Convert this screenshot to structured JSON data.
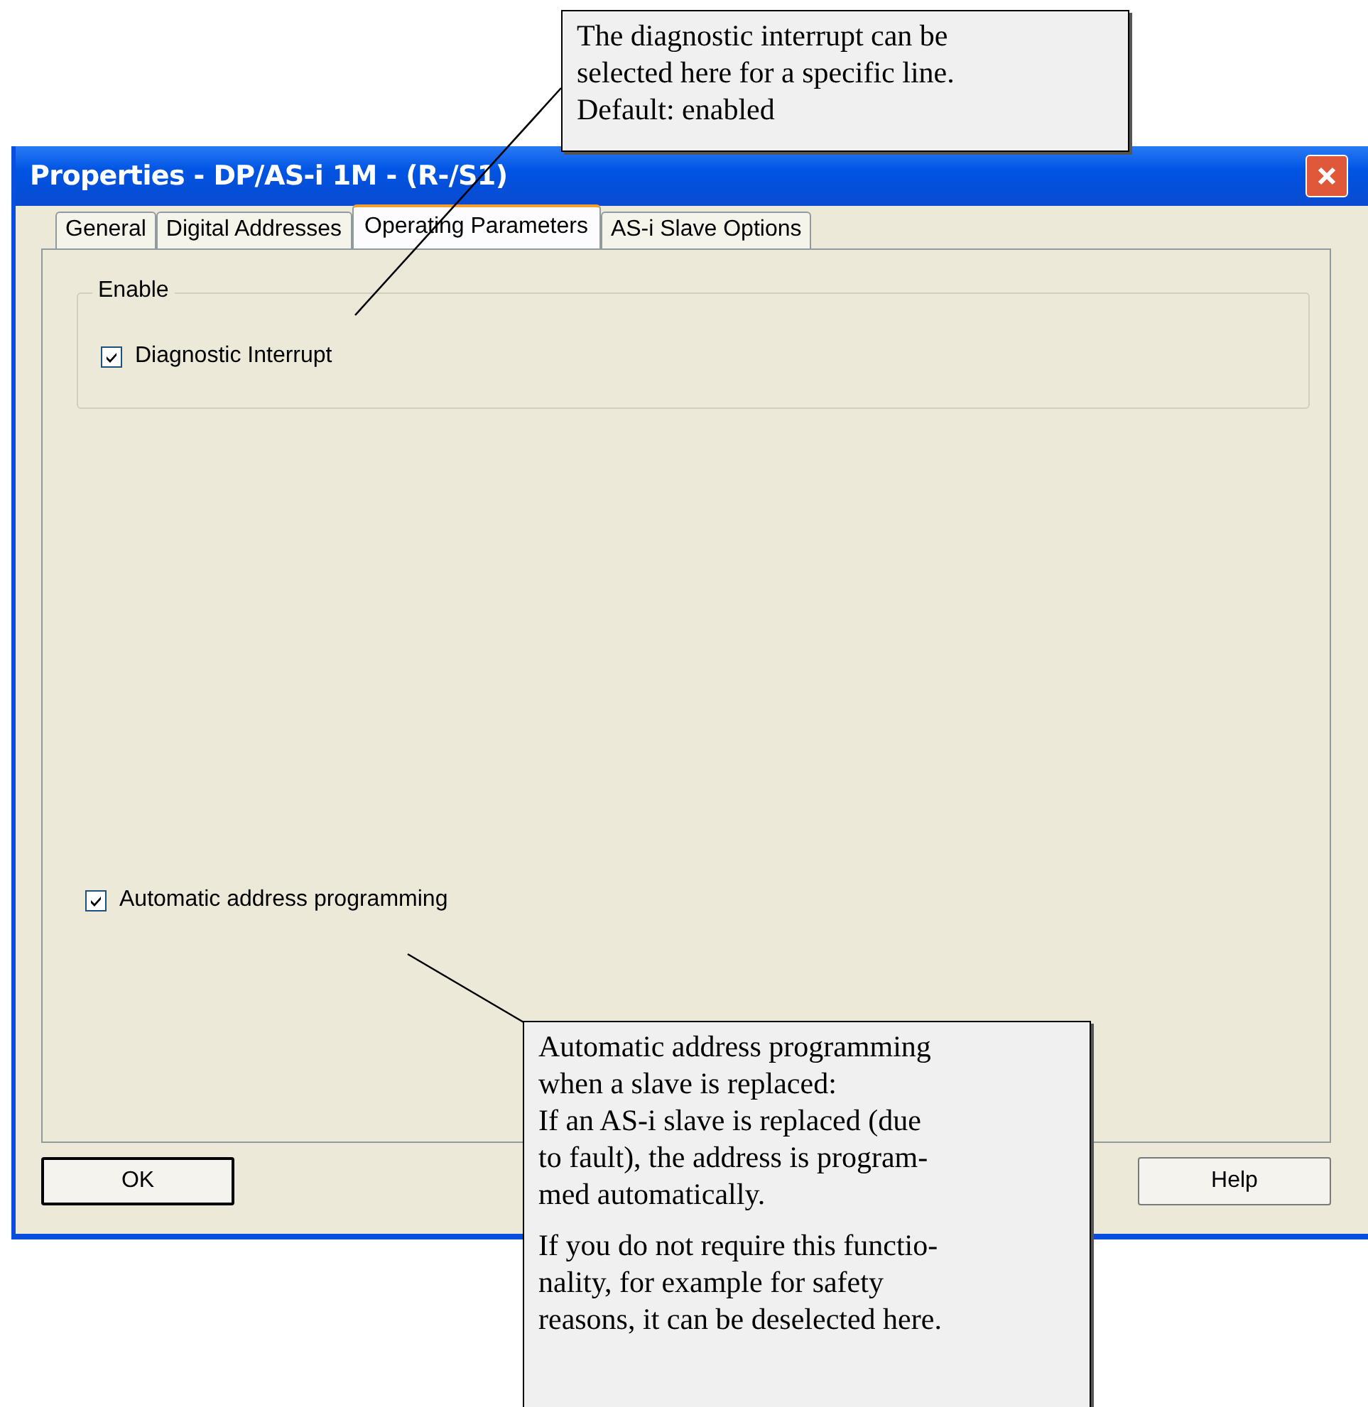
{
  "window": {
    "title": "Properties - DP/AS-i 1M - (R-/S1)"
  },
  "tabs": [
    {
      "label": "General",
      "selected": false
    },
    {
      "label": "Digital Addresses",
      "selected": false
    },
    {
      "label": "Operating Parameters",
      "selected": true
    },
    {
      "label": "AS-i Slave Options",
      "selected": false
    }
  ],
  "group": {
    "label": "Enable",
    "options": [
      {
        "label": "Diagnostic Interrupt",
        "checked": true
      }
    ]
  },
  "options": [
    {
      "label": "Automatic address programming",
      "checked": true
    }
  ],
  "buttons": [
    {
      "label": "OK"
    },
    {
      "label": "Help"
    }
  ],
  "callouts": [
    {
      "paragraphs": [
        "The diagnostic interrupt can be\nselected here for a specific line.\nDefault: enabled"
      ]
    },
    {
      "paragraphs": [
        "Automatic address programming\nwhen a slave is replaced:\nIf an AS-i slave is replaced (due\nto fault), the address is program-\nmed automatically.",
        "If you do not require this functio-\nnality, for example for safety\nreasons, it can be deselected here."
      ]
    }
  ]
}
